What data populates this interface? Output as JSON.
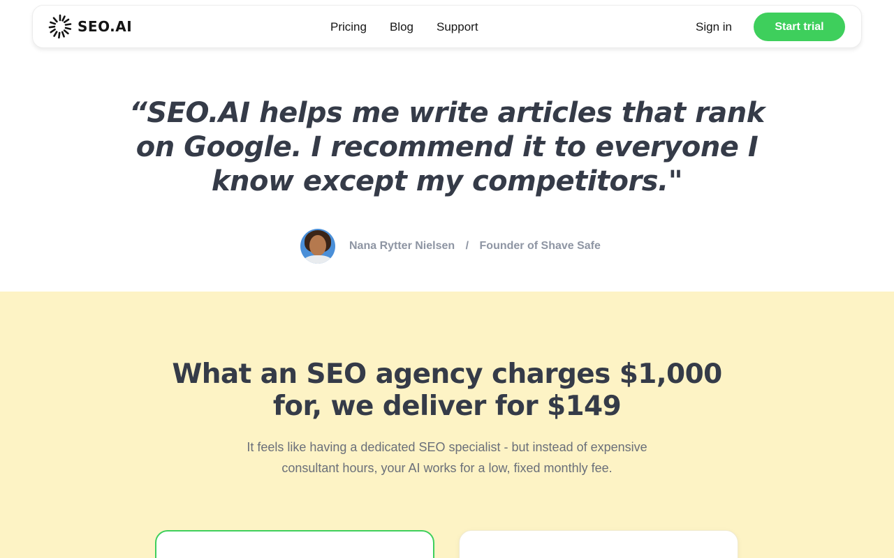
{
  "header": {
    "logo_text": "SEO.AI",
    "nav": [
      "Pricing",
      "Blog",
      "Support"
    ],
    "sign_in": "Sign in",
    "cta": "Start trial"
  },
  "testimonial": {
    "quote": "“SEO.AI helps me write articles that rank on Google. I recommend it to everyone I know except my competitors.\"",
    "author_name": "Nana Rytter Nielsen",
    "separator": "/",
    "author_role": "Founder of Shave Safe"
  },
  "pricing_section": {
    "title": "What an SEO agency charges $1,000 for, we deliver for $149",
    "subtitle": "It feels like having a dedicated SEO specialist - but instead of expensive consultant hours, your AI works for a low, fixed monthly fee."
  },
  "colors": {
    "accent_green": "#3ecf5c",
    "section_background": "#fdf3c5",
    "heading_text": "#353b48"
  },
  "icons": {
    "logo": "sunburst-logo-icon",
    "avatar": "author-avatar-photo"
  }
}
